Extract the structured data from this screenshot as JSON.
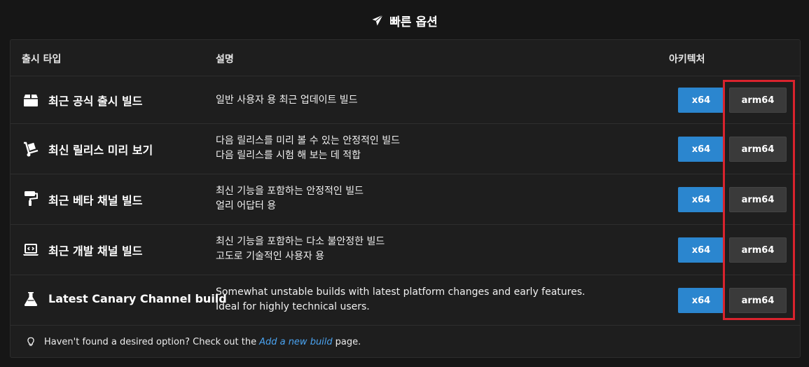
{
  "header": {
    "title": "빠른 옵션",
    "icon": "paper-plane-icon"
  },
  "table": {
    "columns": {
      "type": "출시 타입",
      "description": "설명",
      "architecture": "아키텍처"
    },
    "rows": [
      {
        "icon": "box-icon",
        "name": "최근 공식 출시 빌드",
        "desc_line1": "일반 사용자 용 최근 업데이트 빌드",
        "desc_line2": "",
        "x64": "x64",
        "arm64": "arm64"
      },
      {
        "icon": "hand-truck-icon",
        "name": "최신 릴리스 미리 보기",
        "desc_line1": "다음 릴리스를 미리 볼 수 있는 안정적인 빌드",
        "desc_line2": "다음 릴리스를 시험 해 보는 데 적합",
        "x64": "x64",
        "arm64": "arm64"
      },
      {
        "icon": "paint-roller-icon",
        "name": "최근 베타 채널 빌드",
        "desc_line1": "최신 기능을 포함하는 안정적인 빌드",
        "desc_line2": "얼리 어답터 용",
        "x64": "x64",
        "arm64": "arm64"
      },
      {
        "icon": "laptop-code-icon",
        "name": "최근 개발 채널 빌드",
        "desc_line1": "최신 기능을 포함하는 다소 불안정한 빌드",
        "desc_line2": "고도로 기술적인 사용자 용",
        "x64": "x64",
        "arm64": "arm64"
      },
      {
        "icon": "flask-icon",
        "name": "Latest Canary Channel build",
        "desc_line1": "Somewhat unstable builds with latest platform changes and early features.",
        "desc_line2": "Ideal for highly technical users.",
        "x64": "x64",
        "arm64": "arm64"
      }
    ]
  },
  "footer": {
    "icon": "lightbulb-icon",
    "text_before": "Haven't found a desired option? Check out the",
    "link": "Add a new build",
    "text_after": "page."
  },
  "colors": {
    "background": "#161616",
    "panel": "#1e1e1e",
    "x64_button": "#2b86cf",
    "arm64_button": "#3a3a3a",
    "link": "#4aa3f0",
    "highlight": "#d9232d"
  }
}
